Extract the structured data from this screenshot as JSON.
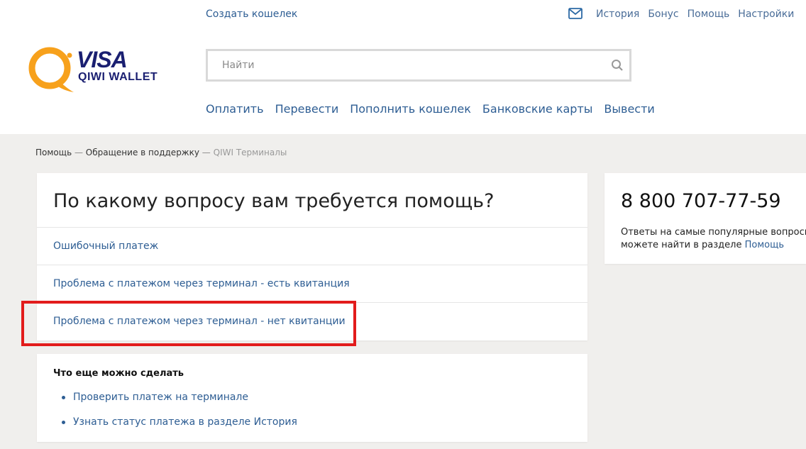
{
  "header": {
    "create_wallet": "Создать кошелек",
    "top_links": [
      "История",
      "Бонус",
      "Помощь",
      "Настройки"
    ],
    "mail_icon": "mail-icon",
    "logo": {
      "visa": "VISA",
      "wallet": "QIWI WALLET"
    }
  },
  "search": {
    "placeholder": "Найти",
    "value": "",
    "icon": "search-icon"
  },
  "nav": [
    "Оплатить",
    "Перевести",
    "Пополнить кошелек",
    "Банковские карты",
    "Вывести"
  ],
  "breadcrumb": {
    "items": [
      "Помощь",
      "Обращение в поддержку",
      "QIWI Терминалы"
    ],
    "separator": "—"
  },
  "main_card": {
    "title": "По какому вопросу вам требуется помощь?",
    "options": [
      "Ошибочный платеж",
      "Проблема с платежом через терминал - есть квитанция",
      "Проблема с платежом через терминал - нет квитанции"
    ],
    "highlighted_index": 2
  },
  "more_card": {
    "title": "Что еще можно сделать",
    "items": [
      "Проверить платеж на терминале",
      "Узнать статус платежа в разделе История"
    ]
  },
  "phone_card": {
    "phone": "8 800 707-77-59",
    "desc_line1": "Ответы на самые популярные вопросы",
    "desc_line2": "можете найти в разделе",
    "desc_link": "Помощь"
  },
  "colors": {
    "link": "#2d5d93",
    "highlight": "#e21c1c",
    "page_bg": "#f0efed",
    "qiwi_orange": "#f7a11c",
    "visa_blue": "#1a1f71"
  }
}
